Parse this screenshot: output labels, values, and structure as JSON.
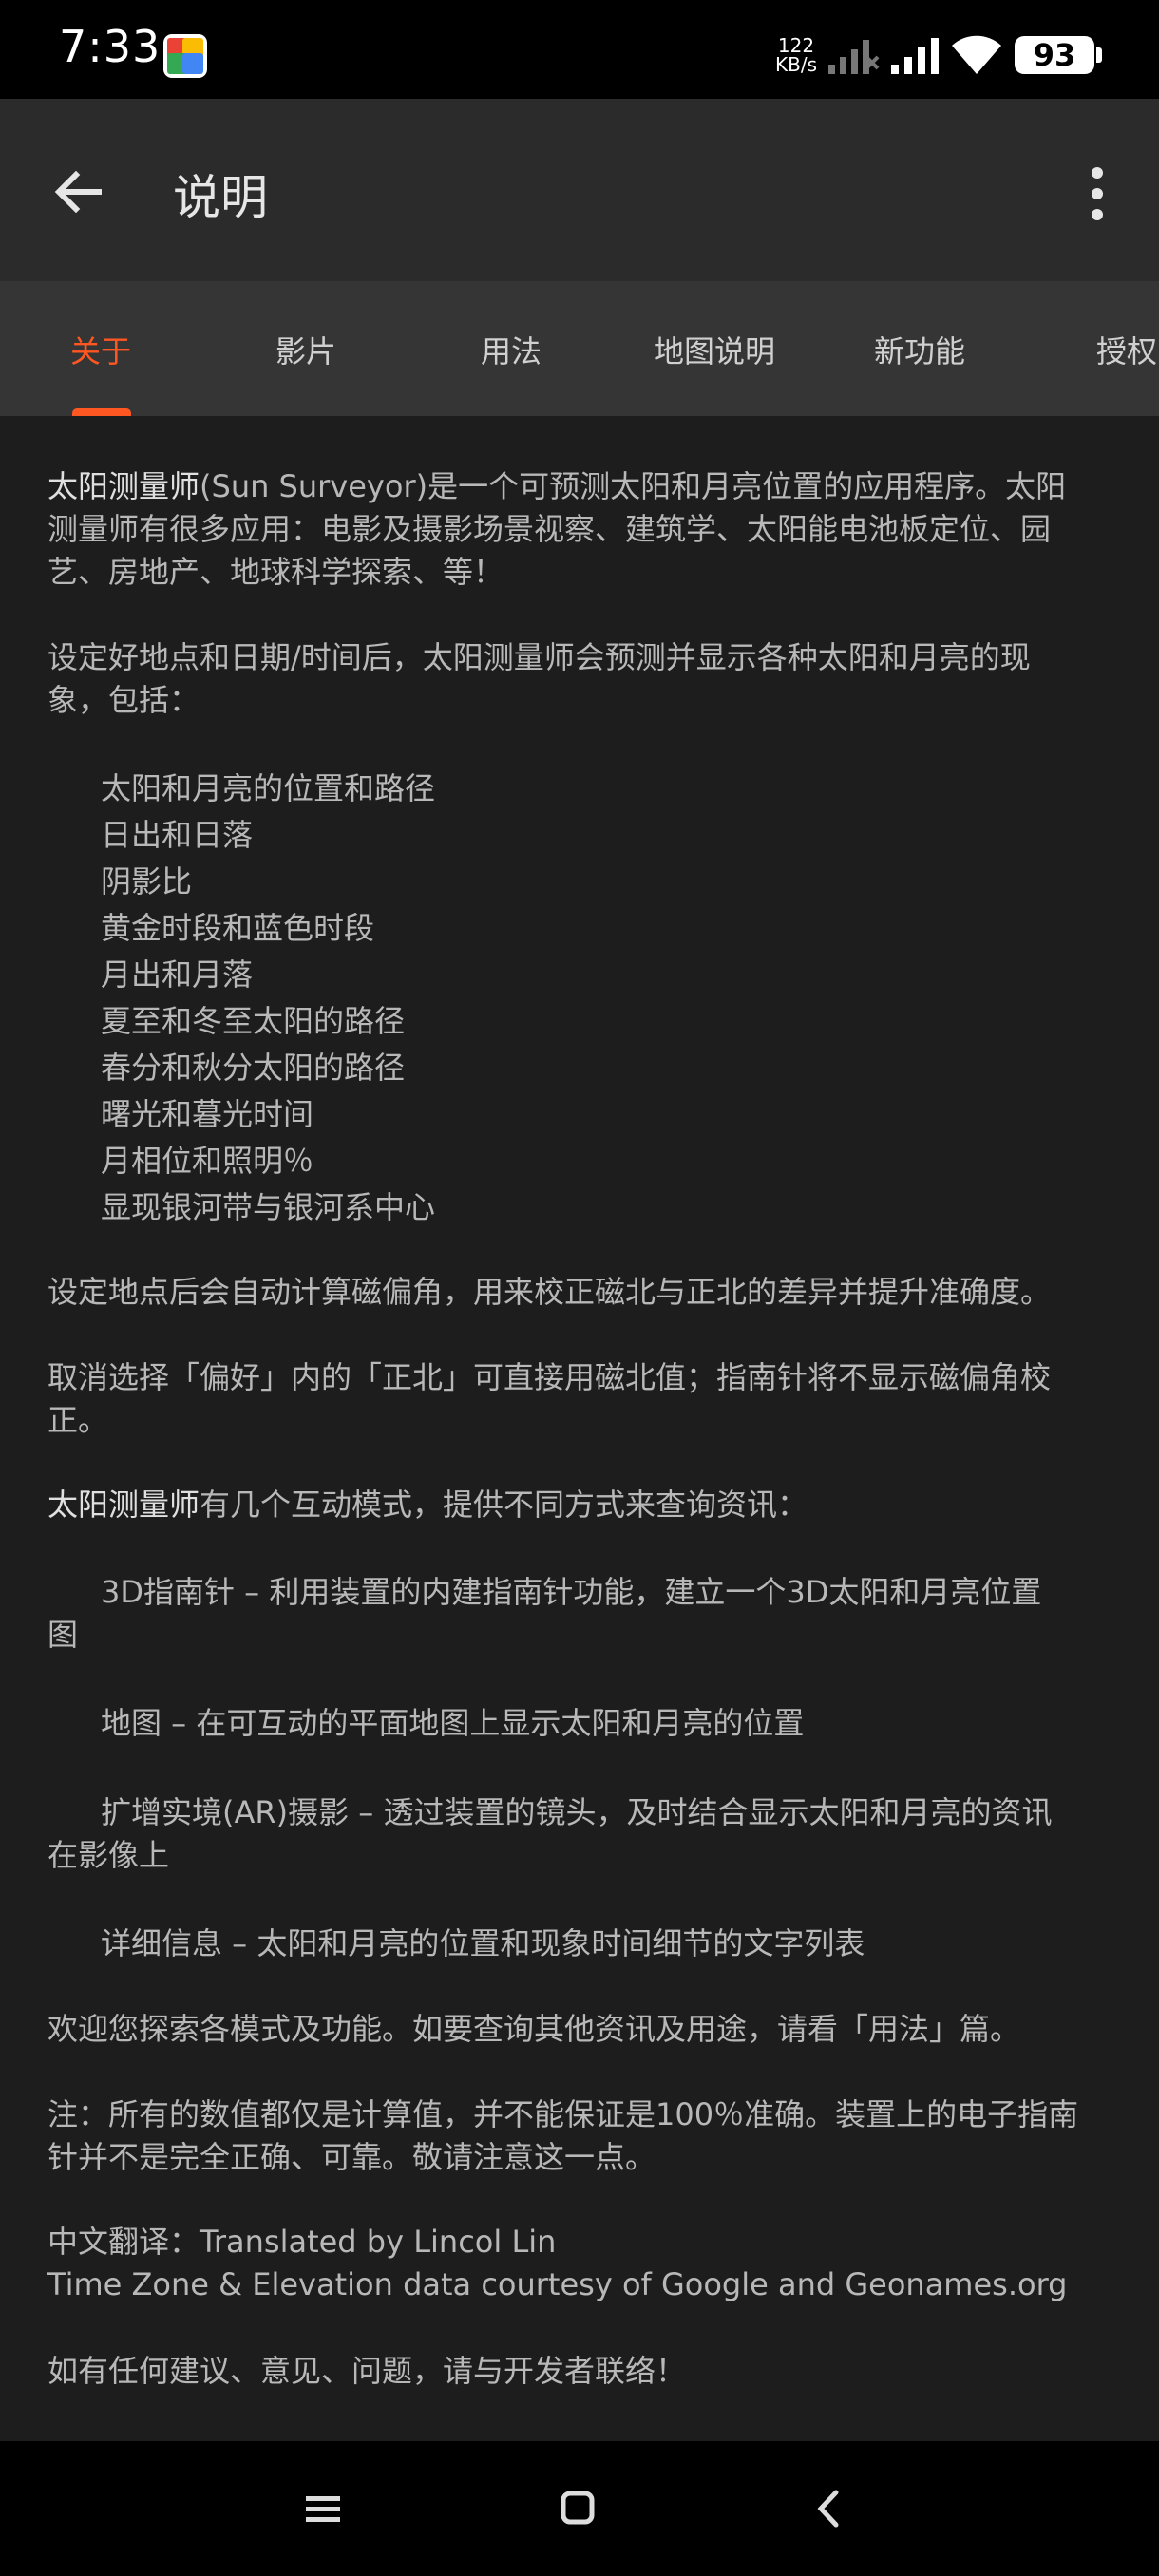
{
  "status_bar": {
    "time": "7:33",
    "net_rate_value": "122",
    "net_rate_unit": "KB/s",
    "battery": "93"
  },
  "app_bar": {
    "title": "说明"
  },
  "tabs": [
    {
      "label": "关于",
      "active": true
    },
    {
      "label": "影片",
      "active": false
    },
    {
      "label": "用法",
      "active": false
    },
    {
      "label": "地图说明",
      "active": false
    },
    {
      "label": "新功能",
      "active": false
    },
    {
      "label": "授权",
      "active": false
    }
  ],
  "content": {
    "intro_name": "太阳测量师",
    "intro_rest": "(Sun Surveyor)是一个可预测太阳和月亮位置的应用程序。太阳",
    "intro_line2": "测量师有很多应用：电影及摄影场景视察、建筑学、太阳能电池板定位、园",
    "intro_line3": "艺、房地产、地球科学探索、等！",
    "setup_line1": "设定好地点和日期/时间后，太阳测量师会预测并显示各种太阳和月亮的现",
    "setup_line2": "象，包括：",
    "features": [
      "太阳和月亮的位置和路径",
      "日出和日落",
      "阴影比",
      "黄金时段和蓝色时段",
      "月出和月落",
      "夏至和冬至太阳的路径",
      "春分和秋分太阳的路径",
      "曙光和暮光时间",
      "月相位和照明％",
      "显现银河带与银河系中心"
    ],
    "declination": "设定地点后会自动计算磁偏角，用来校正磁北与正北的差异并提升准确度。",
    "true_north_line1": "取消选择「偏好」内的「正北」可直接用磁北值；指南针将不显示磁偏角校",
    "true_north_line2": "正。",
    "modes_name": "太阳测量师",
    "modes_rest": "有几个互动模式，提供不同方式来查询资讯：",
    "mode_3d_line1": "3D指南针 – 利用装置的内建指南针功能，建立一个3D太阳和月亮位置",
    "mode_3d_line2": "图",
    "mode_map": "地图 – 在可互动的平面地图上显示太阳和月亮的位置",
    "mode_ar_line1": "扩增实境(AR)摄影 – 透过装置的镜头，及时结合显示太阳和月亮的资讯",
    "mode_ar_line2": "在影像上",
    "mode_details": "详细信息 – 太阳和月亮的位置和现象时间细节的文字列表",
    "welcome": "欢迎您探索各模式及功能。如要查询其他资讯及用途，请看「用法」篇。",
    "note_line1": "注：所有的数值都仅是计算值，并不能保证是100％准确。装置上的电子指南",
    "note_line2": "针并不是完全正确、可靠。敬请注意这一点。",
    "translation": "中文翻译：Translated by Lincol Lin",
    "credits": "Time Zone & Elevation data courtesy of Google and Geonames.org",
    "contact": "如有任何建议、意见、问题，请与开发者联络！"
  },
  "colors": {
    "accent": "#ff5722",
    "app_bar_bg": "#2b2b2b",
    "tabs_bg": "#353535",
    "content_bg": "#1d1d1d"
  },
  "icons": {
    "back": "arrow-left-icon",
    "more": "more-vertical-icon",
    "nav_menu": "menu-icon",
    "nav_home": "home-square-icon",
    "nav_back": "chevron-left-icon"
  }
}
